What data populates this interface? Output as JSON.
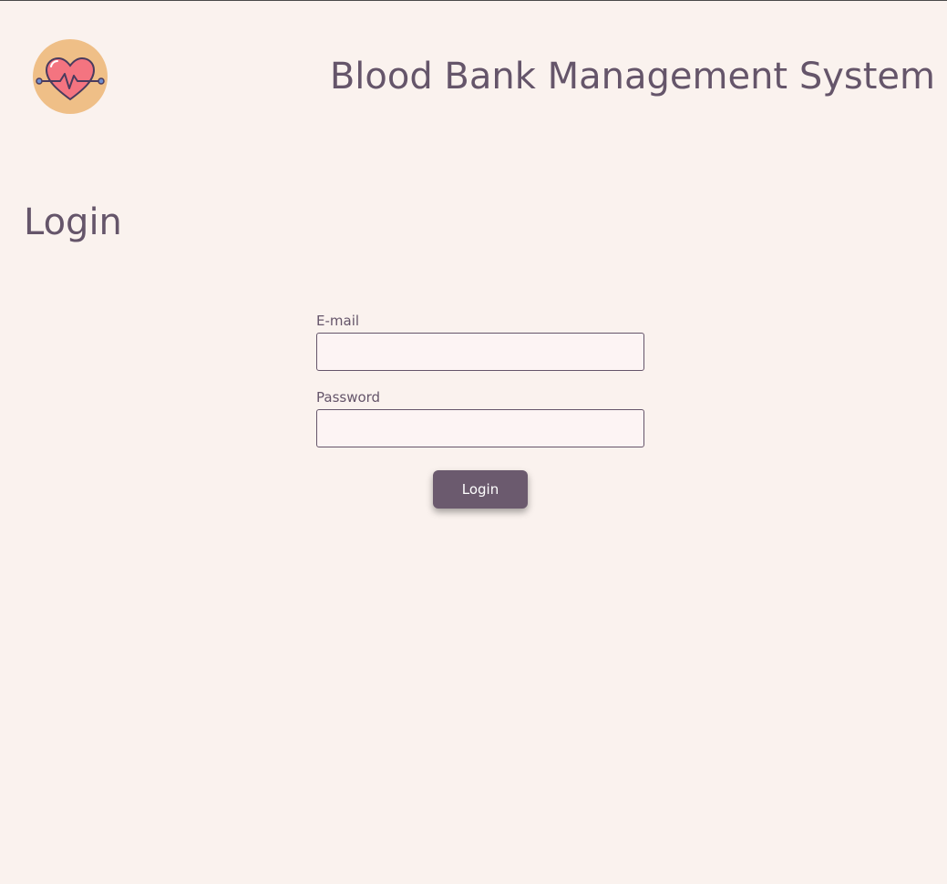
{
  "header": {
    "logo_icon": "heartbeat-icon",
    "app_title": "Blood Bank Management System"
  },
  "page": {
    "title": "Login"
  },
  "form": {
    "email_label": "E-mail",
    "email_value": "",
    "email_placeholder": "",
    "password_label": "Password",
    "password_value": "",
    "password_placeholder": "",
    "submit_label": "Login"
  },
  "colors": {
    "background": "#faf2ee",
    "text": "#65556a",
    "button": "#6b5a6e",
    "input_background": "#fdf4f4",
    "logo_circle": "#efbf87",
    "heart": "#f47480"
  }
}
